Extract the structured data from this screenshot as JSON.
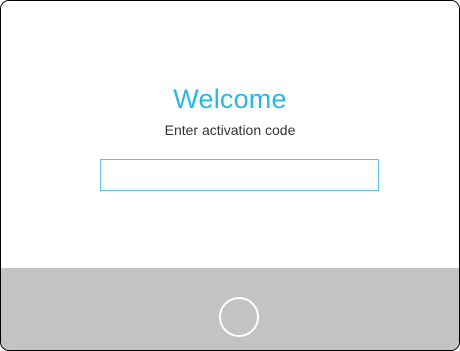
{
  "welcome": {
    "title": "Welcome",
    "subtitle": "Enter activation code"
  },
  "activation_input": {
    "value": "",
    "placeholder": ""
  },
  "footer": {
    "action_icon": "circle-outline-icon"
  },
  "colors": {
    "accent": "#29b8e6",
    "input_border": "#5cc6e8",
    "footer_background": "#c3c3c3",
    "text": "#333333"
  }
}
